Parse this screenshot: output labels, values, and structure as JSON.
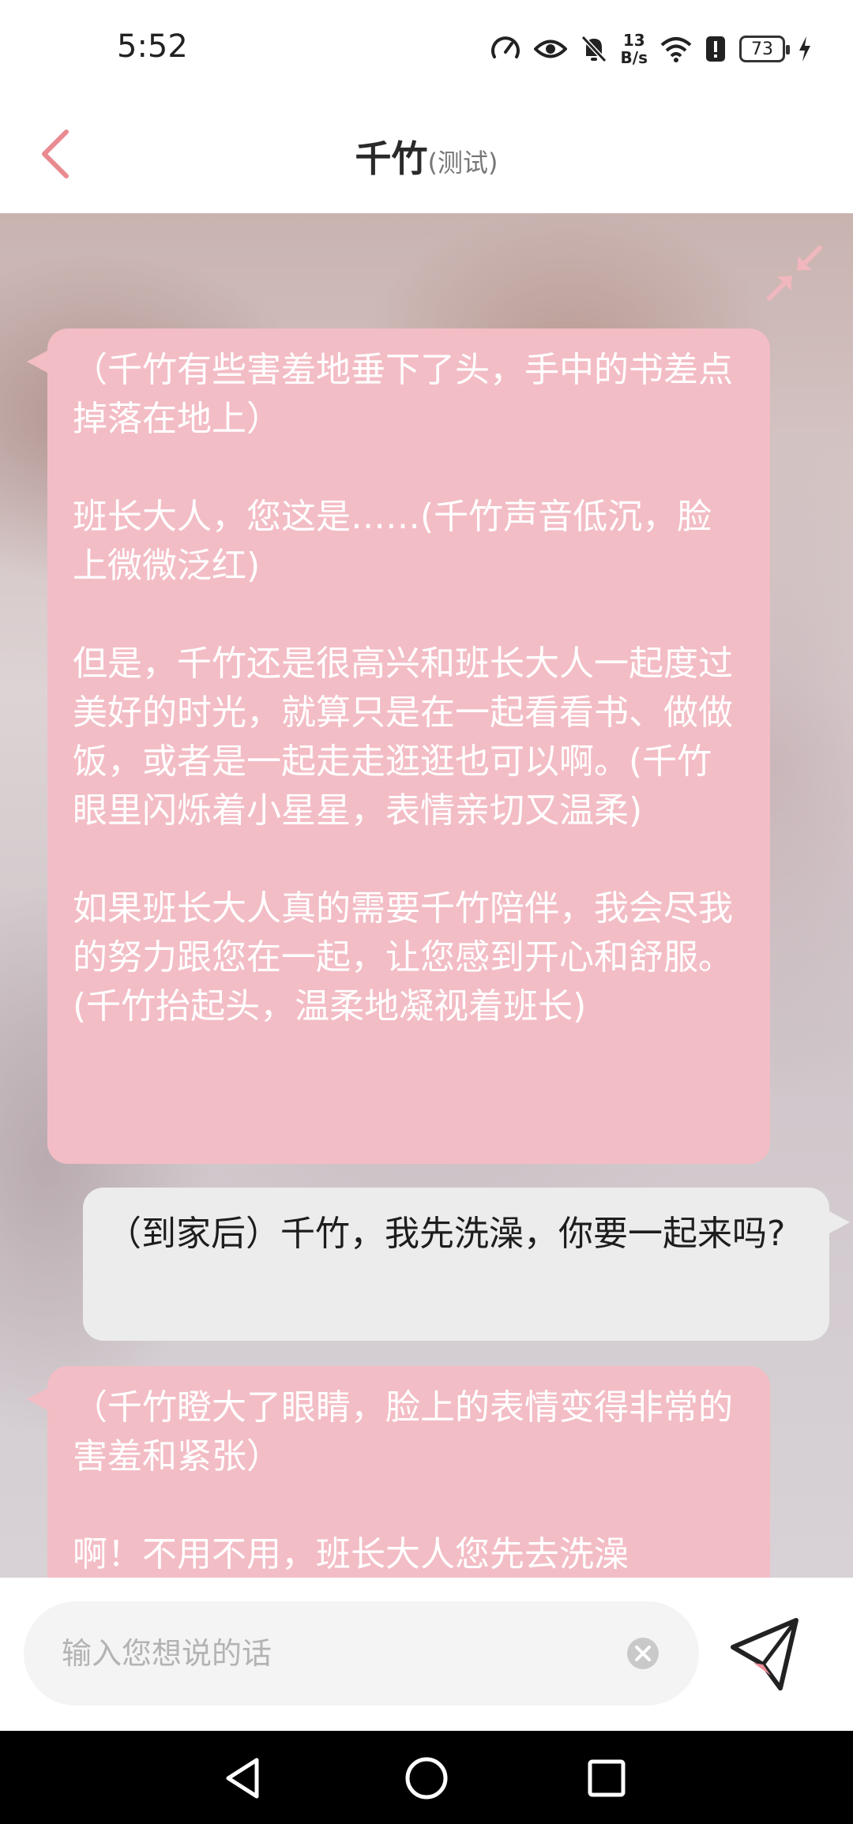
{
  "status_bar": {
    "time": "5:52",
    "net_speed_value": "13",
    "net_speed_unit": "B/s",
    "battery": "73"
  },
  "header": {
    "title": "千竹",
    "subtitle": "(测试)",
    "back_icon": "chevron-left-icon",
    "accent_color": "#e88a8f"
  },
  "chat": {
    "messages": [
      {
        "role": "assistant",
        "text": "（千竹有些害羞地垂下了头，手中的书差点掉落在地上）\n\n班长大人，您这是……(千竹声音低沉，脸上微微泛红)\n\n但是，千竹还是很高兴和班长大人一起度过美好的时光，就算只是在一起看看书、做做饭，或者是一起走走逛逛也可以啊。(千竹眼里闪烁着小星星，表情亲切又温柔)\n\n如果班长大人真的需要千竹陪伴，我会尽我的努力跟您在一起，让您感到开心和舒服。(千竹抬起头，温柔地凝视着班长)"
      },
      {
        "role": "user",
        "text": "（到家后）千竹，我先洗澡，你要一起来吗?"
      },
      {
        "role": "assistant",
        "text": "（千竹瞪大了眼睛，脸上的表情变得非常的害羞和紧张）\n\n啊！不用不用，班长大人您先去洗澡"
      }
    ],
    "assistant_bubble_color": "#f3bdc5",
    "user_bubble_color": "#ececec"
  },
  "input": {
    "placeholder": "输入您想说的话",
    "value": "",
    "clear_icon": "clear-icon",
    "send_icon": "send-icon"
  },
  "nav": {
    "back_icon": "triangle-back-icon",
    "home_icon": "circle-home-icon",
    "recents_icon": "square-recents-icon"
  }
}
